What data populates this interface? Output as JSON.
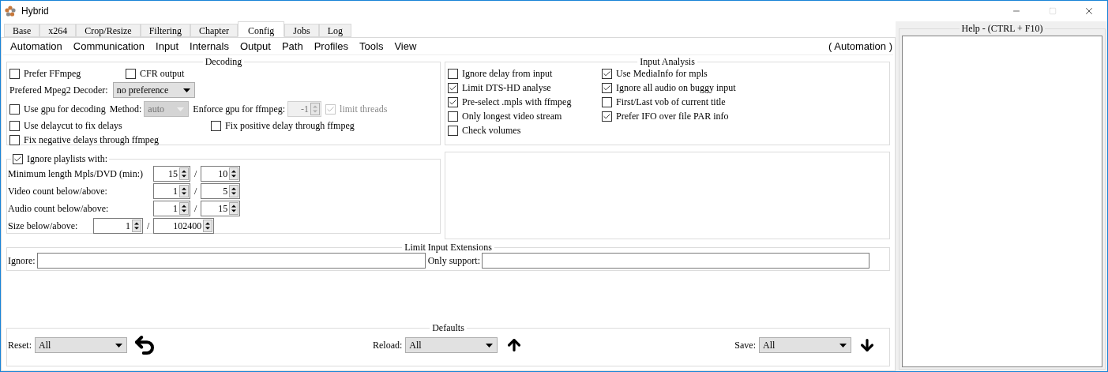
{
  "window": {
    "title": "Hybrid"
  },
  "tabs": [
    {
      "label": "Base",
      "selected": false
    },
    {
      "label": "x264",
      "selected": false
    },
    {
      "label": "Crop/Resize",
      "selected": false
    },
    {
      "label": "Filtering",
      "selected": false
    },
    {
      "label": "Chapter",
      "selected": false
    },
    {
      "label": "Config",
      "selected": true
    },
    {
      "label": "Jobs",
      "selected": false
    },
    {
      "label": "Log",
      "selected": false
    }
  ],
  "subtabs": [
    "Automation",
    "Communication",
    "Input",
    "Internals",
    "Output",
    "Path",
    "Profiles",
    "Tools",
    "View"
  ],
  "section_label": "( Automation )",
  "decoding": {
    "title": "Decoding",
    "prefer_ffmpeg": {
      "label": "Prefer FFmpeg",
      "checked": false
    },
    "cfr_output": {
      "label": "CFR output",
      "checked": false
    },
    "mpeg2_decoder": {
      "label": "Prefered Mpeg2 Decoder:",
      "value": "no preference"
    },
    "use_gpu": {
      "label": "Use gpu for decoding",
      "checked": false
    },
    "method": {
      "label": "Method:",
      "value": "auto",
      "disabled": true
    },
    "enforce_gpu": {
      "label": "Enforce gpu for ffmpeg:",
      "value": "-1",
      "disabled": true
    },
    "limit_threads": {
      "label": "limit threads",
      "checked": true,
      "disabled": true
    },
    "use_delaycut": {
      "label": "Use delaycut to fix delays",
      "checked": false
    },
    "fix_positive": {
      "label": "Fix positive delay through ffmpeg",
      "checked": false
    },
    "fix_negative": {
      "label": "Fix negative delays through ffmpeg",
      "checked": false
    }
  },
  "input_analysis": {
    "title": "Input Analysis",
    "columns": [
      [
        {
          "label": "Ignore delay from input",
          "checked": false
        },
        {
          "label": "Limit DTS-HD analyse",
          "checked": true
        },
        {
          "label": "Pre-select .mpls with ffmpeg",
          "checked": true
        },
        {
          "label": "Only longest video stream",
          "checked": false
        },
        {
          "label": "Check volumes",
          "checked": false
        }
      ],
      [
        {
          "label": "Use MediaInfo for mpls",
          "checked": true
        },
        {
          "label": "Ignore all audio on buggy input",
          "checked": true
        },
        {
          "label": "First/Last vob of current title",
          "checked": false
        },
        {
          "label": "Prefer IFO over file PAR info",
          "checked": true
        }
      ]
    ]
  },
  "playlists": {
    "label": "Ignore playlists with:",
    "checked": true,
    "rows": [
      {
        "kind": "count",
        "label": "Minimum length Mpls/DVD (min:)",
        "values": [
          "15",
          "10"
        ],
        "separator": "/"
      },
      {
        "kind": "count",
        "label": "Video count below/above:",
        "values": [
          "1",
          "5"
        ],
        "separator": "/"
      },
      {
        "kind": "count",
        "label": "Audio count below/above:",
        "values": [
          "1",
          "15"
        ],
        "separator": "/"
      },
      {
        "kind": "size",
        "label": "Size below/above:",
        "values": [
          "1",
          "102400"
        ],
        "separator": "/"
      }
    ]
  },
  "extensions": {
    "title": "Limit Input Extensions",
    "ignore": {
      "label": "Ignore:"
    },
    "only_support": {
      "label": "Only support:"
    }
  },
  "defaults": {
    "title": "Defaults",
    "reset": {
      "label": "Reset:",
      "value": "All"
    },
    "reload": {
      "label": "Reload:",
      "value": "All"
    },
    "save": {
      "label": "Save:",
      "value": "All"
    }
  },
  "help": {
    "title": "Help - (CTRL + F10)"
  }
}
